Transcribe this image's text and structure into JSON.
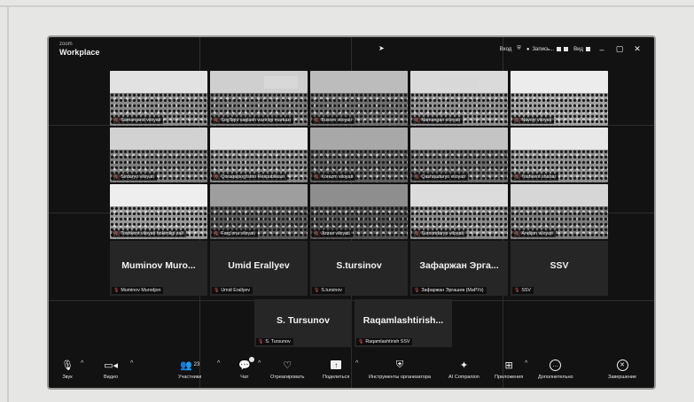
{
  "app": {
    "brand_small": "zoom",
    "brand_main": "Workplace"
  },
  "topbar": {
    "signin": "Вход",
    "recording": "Запись...",
    "view": "Вид"
  },
  "tiles": [
    {
      "name": "Samarqand viloyati"
    },
    {
      "name": "Sog'liqni saqlash vazirligi markazi"
    },
    {
      "name": "Buxoro viloyati"
    },
    {
      "name": "Namangan viloyati"
    },
    {
      "name": "Navoiy viloyati"
    },
    {
      "name": "Sirdaryo viloyati"
    },
    {
      "name": "Qoraqalpog'iston Respublikasi"
    },
    {
      "name": "Xorazm viloyati"
    },
    {
      "name": "Qashqadaryo viloyati"
    },
    {
      "name": "Toshkent shahar"
    },
    {
      "name": "Toshkent viloyati hokimligi zali"
    },
    {
      "name": "Farg'ona viloyati"
    },
    {
      "name": "Jizzax viloyati"
    },
    {
      "name": "Surxondaryo viloyati"
    },
    {
      "name": "Andijon viloyati"
    }
  ],
  "participants": [
    {
      "display": "Muminov Muro...",
      "label": "Muminov Murodjon"
    },
    {
      "display": "Umid Erallyev",
      "label": "Umid Erallyev"
    },
    {
      "display": "S.tursinov",
      "label": "S.tursinov"
    },
    {
      "display": "Зафаржан Эрга...",
      "label": "Зафаржан Эргашев (МаРУз)"
    },
    {
      "display": "SSV",
      "label": "SSV"
    },
    {
      "display": "S. Tursunov",
      "label": "S. Tursunov"
    },
    {
      "display": "Raqamlashtirish...",
      "label": "Raqamlashtirish SSV"
    }
  ],
  "toolbar": {
    "audio": "Звук",
    "video": "Видео",
    "participants": "Участники",
    "participants_count": "23",
    "chat": "Чат",
    "react": "Отреагировать",
    "share": "Поделиться",
    "host_tools": "Инструменты организатора",
    "ai": "AI Companion",
    "apps": "Приложения",
    "more": "Дополнительно",
    "end": "Завершение"
  },
  "icons": {
    "audio": "microphone-icon",
    "video": "camera-icon",
    "participants": "people-icon",
    "chat": "chat-icon",
    "react": "heart-icon",
    "share": "share-screen-icon",
    "host_tools": "shield-icon",
    "ai": "sparkle-icon",
    "apps": "apps-icon",
    "more": "more-icon",
    "end": "end-icon"
  }
}
